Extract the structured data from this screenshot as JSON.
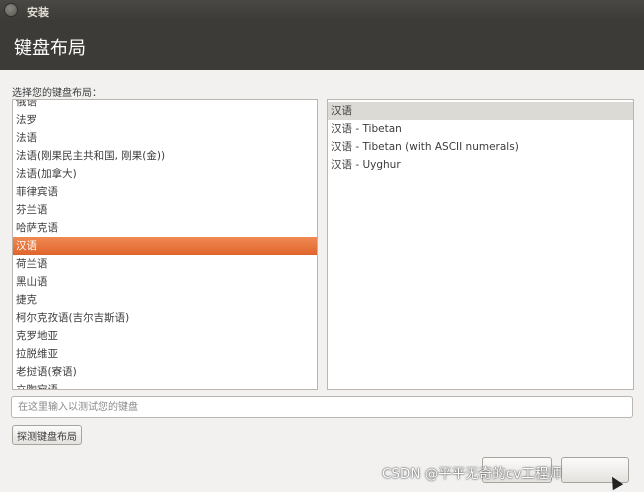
{
  "window": {
    "title": "安装"
  },
  "header": {
    "title": "键盘布局"
  },
  "prompt": "选择您的键盘布局：",
  "layouts": [
    "俄语",
    "法罗",
    "法语",
    "法语(刚果民主共和国, 刚果(金))",
    "法语(加拿大)",
    "菲律宾语",
    "芬兰语",
    "哈萨克语",
    "汉语",
    "荷兰语",
    "黑山语",
    "捷克",
    "柯尔克孜语(吉尔吉斯语)",
    "克罗地亚",
    "拉脱维亚",
    "老挝语(寮语)",
    "立陶宛语"
  ],
  "selected_layout_index": 8,
  "variants": [
    "汉语",
    "汉语 - Tibetan",
    "汉语 - Tibetan (with ASCII numerals)",
    "汉语 - Uyghur"
  ],
  "selected_variant_index": 0,
  "test_input": {
    "placeholder": "在这里输入以测试您的键盘",
    "value": ""
  },
  "buttons": {
    "detect": "探测键盘布局",
    "back": "",
    "continue": ""
  },
  "watermark": "CSDN @平平无奇的cv工程师",
  "colors": {
    "selection": "#e9733a",
    "header_bg": "#3c3b37"
  }
}
